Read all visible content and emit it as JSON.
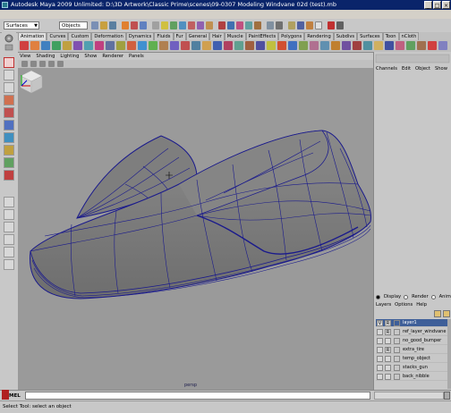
{
  "window": {
    "title": "Autodesk Maya 2009 Unlimited: D:\\3D Artwork\\Classic Prime\\scenes\\09-0307 Modeling Windvane 02d (test).mb",
    "buttons": [
      "_",
      "□",
      "×"
    ]
  },
  "statusline": {
    "mode": "Surfaces",
    "selection_mask": "Objects"
  },
  "shelf": {
    "tabs": [
      "Animation",
      "Curves",
      "Custom",
      "Deformation",
      "Dynamics",
      "Fluids",
      "Fur",
      "General",
      "Hair",
      "Muscle",
      "PaintEffects",
      "Polygons",
      "Rendering",
      "Subdivs",
      "Surfaces",
      "Toon",
      "nCloth"
    ],
    "active_tab": "Animation"
  },
  "viewport": {
    "menus": [
      "View",
      "Shading",
      "Lighting",
      "Show",
      "Renderer",
      "Panels"
    ],
    "camera_label": "persp",
    "background": "#9a9a9a",
    "wire_color": "#1a1a8c",
    "surface_color": "#808080"
  },
  "channel_box": {
    "menus": [
      "Channels",
      "Edit",
      "Object",
      "Show"
    ]
  },
  "layer_editor": {
    "modes": [
      "Display",
      "Render",
      "Anim"
    ],
    "active_mode": "Display",
    "menus": [
      "Layers",
      "Options",
      "Help"
    ],
    "layers": [
      {
        "v": "V",
        "r": "R",
        "name": "layer1",
        "selected": true
      },
      {
        "v": "",
        "r": "R",
        "name": "ref_layer_windvane",
        "selected": false
      },
      {
        "v": "",
        "r": "",
        "name": "no_good_bumper",
        "selected": false
      },
      {
        "v": "",
        "r": "R",
        "name": "extra_tire",
        "selected": false
      },
      {
        "v": "",
        "r": "",
        "name": "temp_object",
        "selected": false
      },
      {
        "v": "",
        "r": "",
        "name": "stacks_gun",
        "selected": false
      },
      {
        "v": "",
        "r": "",
        "name": "back_nibble",
        "selected": false
      }
    ]
  },
  "command_line": {
    "label": "MEL",
    "value": ""
  },
  "help_line": {
    "text": "Select Tool: select an object"
  }
}
